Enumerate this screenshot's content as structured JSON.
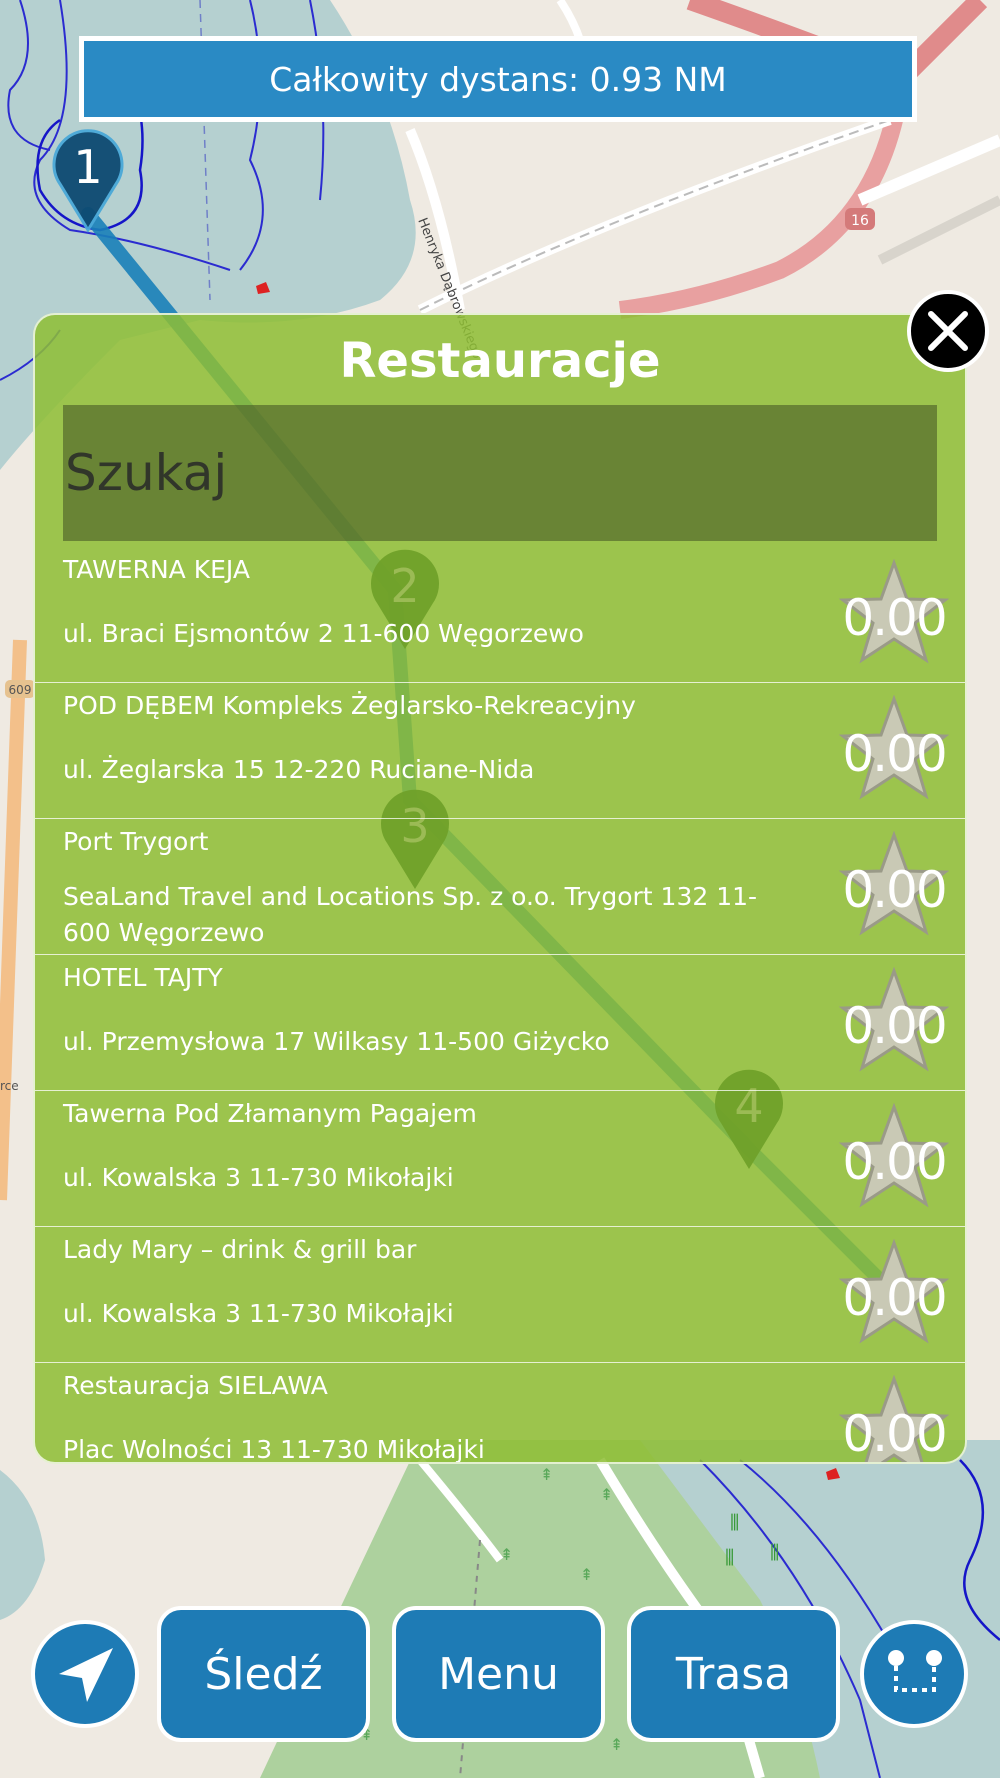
{
  "header": {
    "distance_text": "Całkowity dystans: 0.93 NM"
  },
  "waypoints": [
    "1",
    "2",
    "3",
    "4"
  ],
  "map_labels": {
    "street_1": "Henryka Dąbrowskiego",
    "road_number": "16",
    "left_road_number": "609",
    "left_fragment": "rce"
  },
  "panel": {
    "title": "Restauracje",
    "search_placeholder": "Szukaj",
    "items": [
      {
        "name": "TAWERNA KEJA",
        "address": "ul. Braci Ejsmontów 2 11-600 Węgorzewo",
        "rating": "0.00"
      },
      {
        "name": "POD DĘBEM Kompleks Żeglarsko-Rekreacyjny",
        "address": "ul. Żeglarska 15 12-220 Ruciane-Nida",
        "rating": "0.00"
      },
      {
        "name": "Port Trygort",
        "address": "SeaLand Travel and Locations Sp. z o.o. Trygort 132 11-600 Węgorzewo",
        "rating": "0.00"
      },
      {
        "name": "HOTEL TAJTY",
        "address": "ul. Przemysłowa 17 Wilkasy 11-500 Giżycko",
        "rating": "0.00"
      },
      {
        "name": "Tawerna Pod Złamanym Pagajem",
        "address": "ul. Kowalska 3 11-730 Mikołajki",
        "rating": "0.00"
      },
      {
        "name": "Lady Mary – drink & grill bar",
        "address": "ul. Kowalska 3 11-730 Mikołajki",
        "rating": "0.00"
      },
      {
        "name": "Restauracja SIELAWA",
        "address": "Plac Wolności 13 11-730 Mikołajki",
        "rating": "0.00"
      }
    ]
  },
  "toolbar": {
    "track_label": "Śledź",
    "menu_label": "Menu",
    "route_label": "Trasa"
  },
  "colors": {
    "banner": "#2a8ac4",
    "panel": "#8ebe34",
    "button": "#1e7bb5",
    "water": "#b5d0d0",
    "land": "#efeae2",
    "forest": "#add19e"
  }
}
